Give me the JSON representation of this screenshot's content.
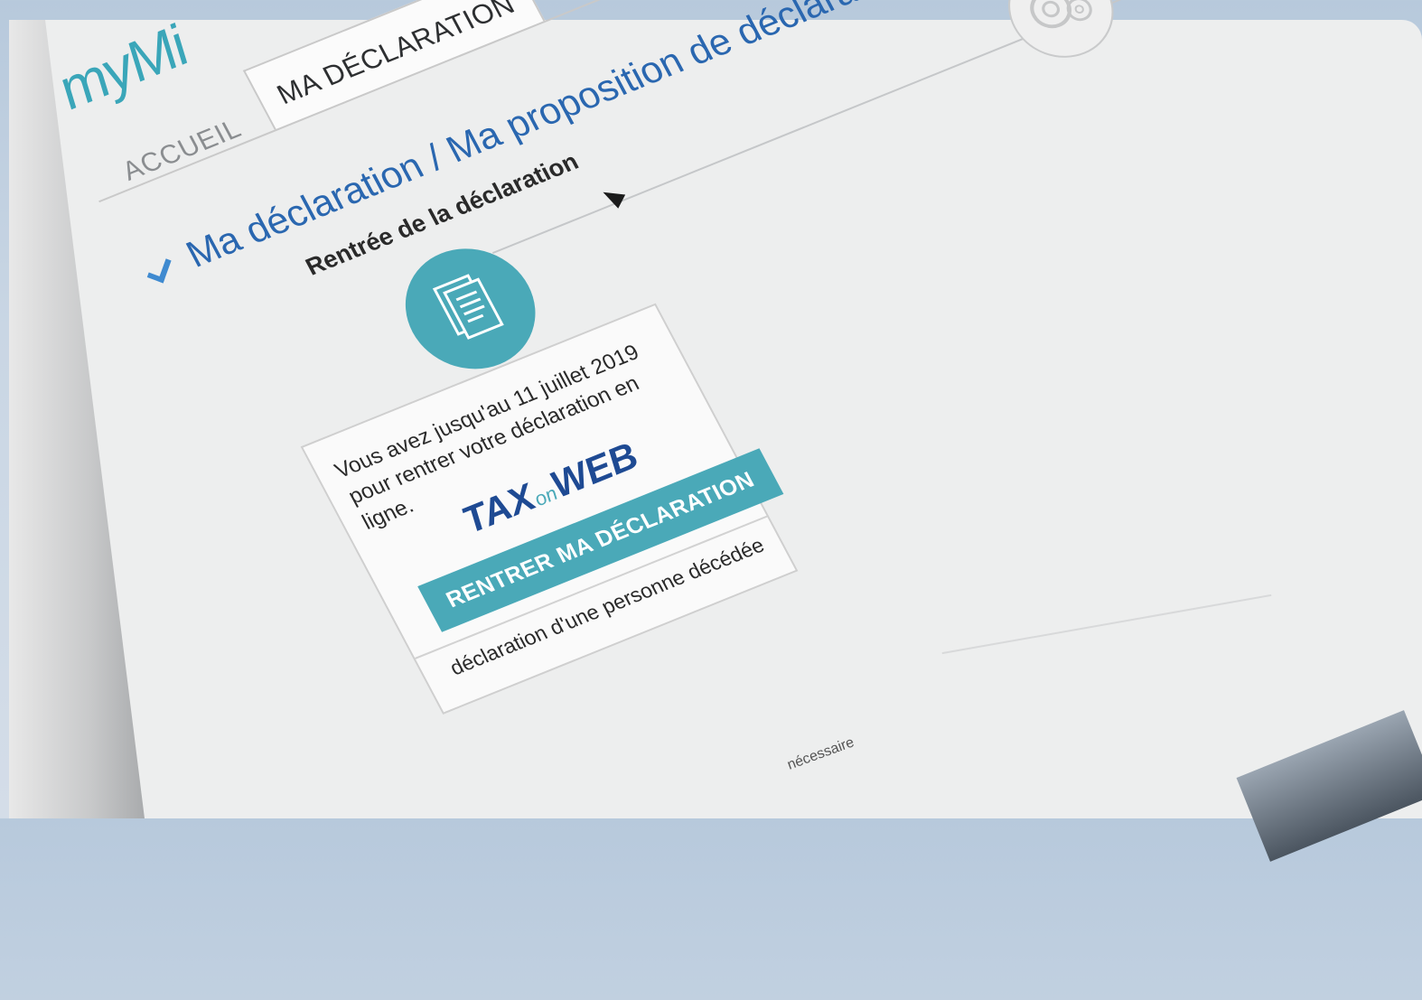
{
  "header": {
    "brand": "myMi",
    "tabs": [
      "ACCUEIL",
      "MA DÉCLARATION"
    ]
  },
  "breadcrumb": "Ma déclaration / Ma proposition de déclaration",
  "steps": [
    {
      "title": "Rentrée de la déclaration",
      "icon": "document-icon"
    },
    {
      "title": "",
      "icon": "gear-icon"
    }
  ],
  "card": {
    "text": "Vous avez jusqu'au 11 juillet 2019 pour rentrer votre déclaration en ligne.",
    "logo": {
      "tax": "TAX",
      "on": "on",
      "web": "WEB"
    },
    "cta": "RENTRER MA DÉCLARATION",
    "secondary": "déclaration d'une personne décédée"
  },
  "footer": {
    "note": "nécessaire"
  },
  "colors": {
    "accent": "#4aa9b8",
    "link": "#2a67b0",
    "brand_dark": "#1e4a93"
  }
}
